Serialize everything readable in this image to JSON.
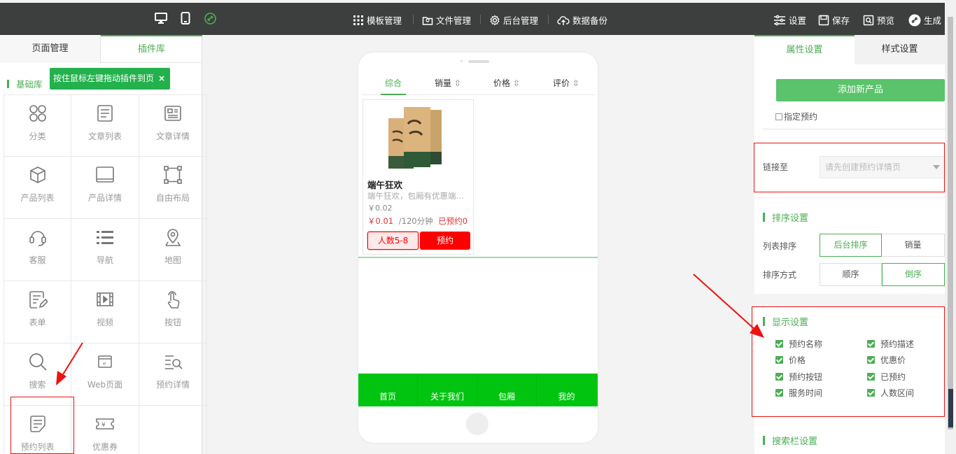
{
  "topbar": {
    "nav": [
      {
        "label": "模板管理",
        "icon": "grid-icon"
      },
      {
        "label": "文件管理",
        "icon": "folder-icon"
      },
      {
        "label": "后台管理",
        "icon": "gear-icon"
      },
      {
        "label": "数据备份",
        "icon": "cloud-upload-icon"
      }
    ],
    "actions": [
      {
        "label": "设置",
        "icon": "sliders-icon"
      },
      {
        "label": "保存",
        "icon": "save-icon"
      },
      {
        "label": "预览",
        "icon": "preview-icon"
      },
      {
        "label": "生成",
        "icon": "generate-icon"
      }
    ],
    "devices": [
      "desktop-icon",
      "mobile-icon",
      "mini-program-icon"
    ]
  },
  "left": {
    "tabs": [
      "页面管理",
      "插件库"
    ],
    "active_tab": "插件库",
    "library_title": "基础库",
    "tooltip": "按住鼠标左键拖动插件到页",
    "tooltip_close": "×",
    "plugins": [
      {
        "label": "分类",
        "icon": "category-icon"
      },
      {
        "label": "文章列表",
        "icon": "article-list-icon"
      },
      {
        "label": "文章详情",
        "icon": "article-detail-icon"
      },
      {
        "label": "产品列表",
        "icon": "product-box-icon"
      },
      {
        "label": "产品详情",
        "icon": "product-detail-icon"
      },
      {
        "label": "自由布局",
        "icon": "free-layout-icon"
      },
      {
        "label": "客服",
        "icon": "headset-icon"
      },
      {
        "label": "导航",
        "icon": "nav-list-icon"
      },
      {
        "label": "地图",
        "icon": "map-pin-icon"
      },
      {
        "label": "表单",
        "icon": "form-icon"
      },
      {
        "label": "视频",
        "icon": "video-icon"
      },
      {
        "label": "按钮",
        "icon": "tap-icon"
      },
      {
        "label": "搜索",
        "icon": "search-icon"
      },
      {
        "label": "Web页面",
        "icon": "web-page-icon"
      },
      {
        "label": "预约详情",
        "icon": "booking-detail-icon"
      },
      {
        "label": "预约列表",
        "icon": "booking-list-icon"
      },
      {
        "label": "优惠券",
        "icon": "coupon-icon"
      }
    ]
  },
  "phone": {
    "sort_tabs": [
      "综合",
      "销量",
      "价格",
      "评价"
    ],
    "active_sort": "综合",
    "product": {
      "name": "端午狂欢",
      "desc": "端午狂欢，包厢有优惠端...",
      "original_price": "￥0.02",
      "price": "￥0.01",
      "duration": "/120分钟",
      "booked": "已预约0",
      "people_btn": "人数5-8",
      "book_btn": "预约"
    },
    "footer": [
      "首页",
      "关于我们",
      "包厢",
      "我的"
    ]
  },
  "right": {
    "tabs": [
      "属性设置",
      "样式设置"
    ],
    "active_tab": "属性设置",
    "add_product": "添加新产品",
    "appoint_label": "指定预约",
    "link_label": "链接至",
    "link_placeholder": "请先创建预约详情页",
    "sort_section": "排序设置",
    "list_sort_label": "列表排序",
    "list_sort_options": [
      "后台排序",
      "销量"
    ],
    "list_sort_selected": "后台排序",
    "sort_mode_label": "排序方式",
    "sort_mode_options": [
      "顺序",
      "倒序"
    ],
    "sort_mode_selected": "倒序",
    "display_section": "显示设置",
    "display_options": [
      "预约名称",
      "预约描述",
      "价格",
      "优惠价",
      "预约按钮",
      "已预约",
      "服务时间",
      "人数区间"
    ],
    "search_section": "搜索栏设置"
  },
  "colors": {
    "accent": "#4cae54",
    "topbar": "#3c3f3e",
    "footer": "#00c40f",
    "annotation": "#e11111",
    "book": "#ff0000"
  }
}
